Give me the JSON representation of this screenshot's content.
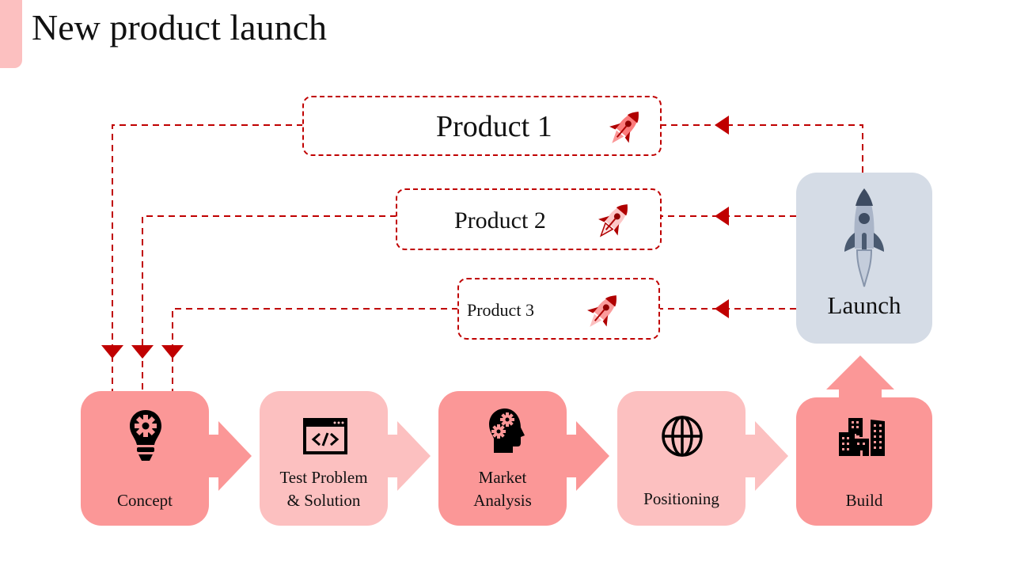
{
  "title": "New product launch",
  "colors": {
    "accent_dark": "#fb9797",
    "accent_light": "#fcc0c0",
    "connector_red": "#c00000",
    "launch_bg": "#d5dce6",
    "rocket_slate": "#4a5a70"
  },
  "products": [
    {
      "label": "Product 1",
      "icon": "rocket-icon"
    },
    {
      "label": "Product 2",
      "icon": "rocket-icon"
    },
    {
      "label": "Product 3",
      "icon": "rocket-icon"
    }
  ],
  "launch": {
    "label": "Launch",
    "icon": "rocket-icon"
  },
  "steps": [
    {
      "label": "Concept",
      "icon": "lightbulb-gear-icon"
    },
    {
      "label": "Test Problem",
      "label2": "& Solution",
      "icon": "code-window-icon"
    },
    {
      "label": "Market",
      "label2": "Analysis",
      "icon": "head-gears-icon"
    },
    {
      "label": "Positioning",
      "icon": "globe-icon"
    },
    {
      "label": "Build",
      "icon": "buildings-icon"
    }
  ]
}
